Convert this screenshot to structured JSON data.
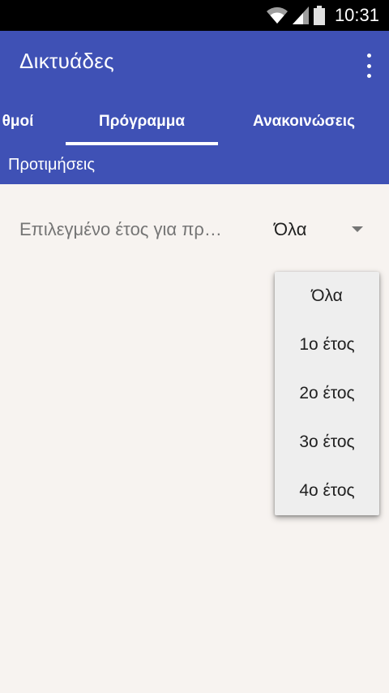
{
  "status_bar": {
    "time": "10:31",
    "icons": [
      "wifi-icon",
      "signal-icon",
      "battery-icon"
    ]
  },
  "app_bar": {
    "title": "Δικτυάδες",
    "menu_icon": "more-vert-icon",
    "color": "#3f51b5"
  },
  "tabs": [
    {
      "label": "θμοί",
      "selected": false
    },
    {
      "label": "Πρόγραμμα",
      "selected": true
    },
    {
      "label": "Ανακοινώσεις",
      "selected": false
    }
  ],
  "subheader": "Προτιμήσεις",
  "preference": {
    "label": "Επιλεγμένο έτος για πρ…",
    "selected_value": "Όλα",
    "options": [
      "Όλα",
      "1ο έτος",
      "2ο έτος",
      "3ο έτος",
      "4ο έτος"
    ]
  }
}
